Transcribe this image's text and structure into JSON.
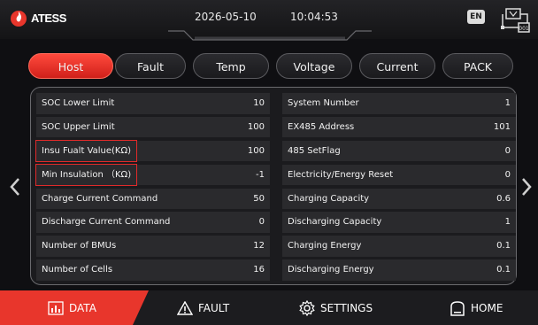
{
  "header": {
    "logo_text": "ATESS",
    "date": "2026-05-10",
    "time": "10:04:53",
    "language": "EN"
  },
  "tabs": [
    {
      "label": "Host",
      "active": true
    },
    {
      "label": "Fault",
      "active": false
    },
    {
      "label": "Temp",
      "active": false
    },
    {
      "label": "Voltage",
      "active": false
    },
    {
      "label": "Current",
      "active": false
    },
    {
      "label": "PACK",
      "active": false
    }
  ],
  "left_rows": [
    {
      "label": "SOC Lower Limit",
      "value": "10"
    },
    {
      "label": "SOC Upper Limit",
      "value": "100"
    },
    {
      "label": "Insu Fualt Value(KΩ)",
      "value": "100"
    },
    {
      "label": "Min Insulation （KΩ)",
      "value": "-1"
    },
    {
      "label": "Charge Current Command",
      "value": "50"
    },
    {
      "label": "Discharge Current Command",
      "value": "0"
    },
    {
      "label": "Number of BMUs",
      "value": "12"
    },
    {
      "label": "Number of Cells",
      "value": "16"
    }
  ],
  "right_rows": [
    {
      "label": "System Number",
      "value": "1"
    },
    {
      "label": "EX485 Address",
      "value": "101"
    },
    {
      "label": "485 SetFlag",
      "value": "0"
    },
    {
      "label": "Electricity/Energy Reset",
      "value": "0"
    },
    {
      "label": "Charging Capacity",
      "value": "0.6"
    },
    {
      "label": "Discharging Capacity",
      "value": "1"
    },
    {
      "label": "Charging Energy",
      "value": "0.1"
    },
    {
      "label": "Discharging Energy",
      "value": "0.1"
    }
  ],
  "bottom_nav": {
    "data": "DATA",
    "fault": "FAULT",
    "settings": "SETTINGS",
    "home": "HOME"
  },
  "colors": {
    "accent": "#e8362c",
    "highlight_border": "#e02a2a"
  }
}
